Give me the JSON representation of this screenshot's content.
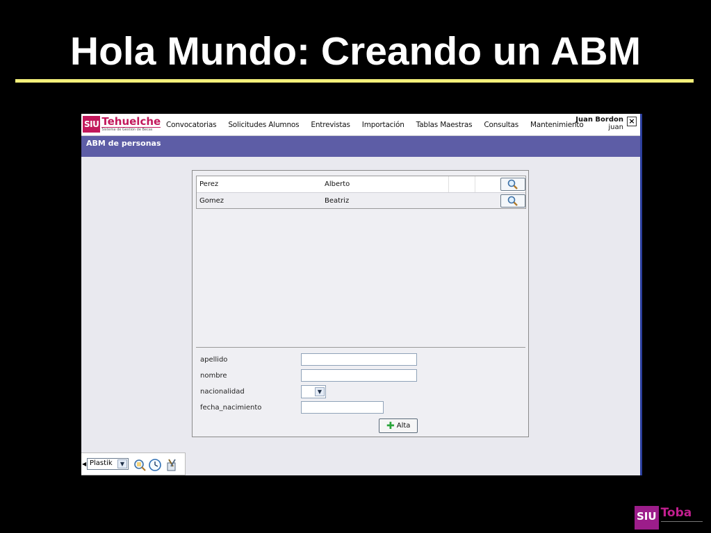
{
  "slide": {
    "title": "Hola Mundo: Creando un ABM"
  },
  "app": {
    "logo": {
      "siu": "SIU",
      "name": "Tehuelche",
      "subtitle": "Sistema de Gestión de Becas"
    },
    "menu": [
      "Convocatorias",
      "Solicitudes Alumnos",
      "Entrevistas",
      "Importación",
      "Tablas Maestras",
      "Consultas",
      "Mantenimiento"
    ],
    "user": {
      "name": "Juan Bordon",
      "login": "juan"
    },
    "close_label": "×",
    "band_title": "ABM de personas"
  },
  "list": {
    "rows": [
      {
        "apellido": "Perez",
        "nombre": "Alberto"
      },
      {
        "apellido": "Gomez",
        "nombre": "Beatriz"
      }
    ]
  },
  "form": {
    "labels": {
      "apellido": "apellido",
      "nombre": "nombre",
      "nacionalidad": "nacionalidad",
      "fecha_nacimiento": "fecha_nacimiento"
    },
    "values": {
      "apellido": "",
      "nombre": "",
      "nacionalidad": "",
      "fecha_nacimiento": ""
    },
    "submit_label": "Alta"
  },
  "footer": {
    "skin": "Plastik"
  },
  "brand": {
    "siu": "SIU",
    "name": "Toba"
  },
  "colors": {
    "accent_band": "#5d5da6",
    "siu_pink": "#c2185b",
    "title_rule": "#f4f07a"
  },
  "icons": [
    "magnifier-icon",
    "plus-icon",
    "clock-icon",
    "tools-icon"
  ]
}
